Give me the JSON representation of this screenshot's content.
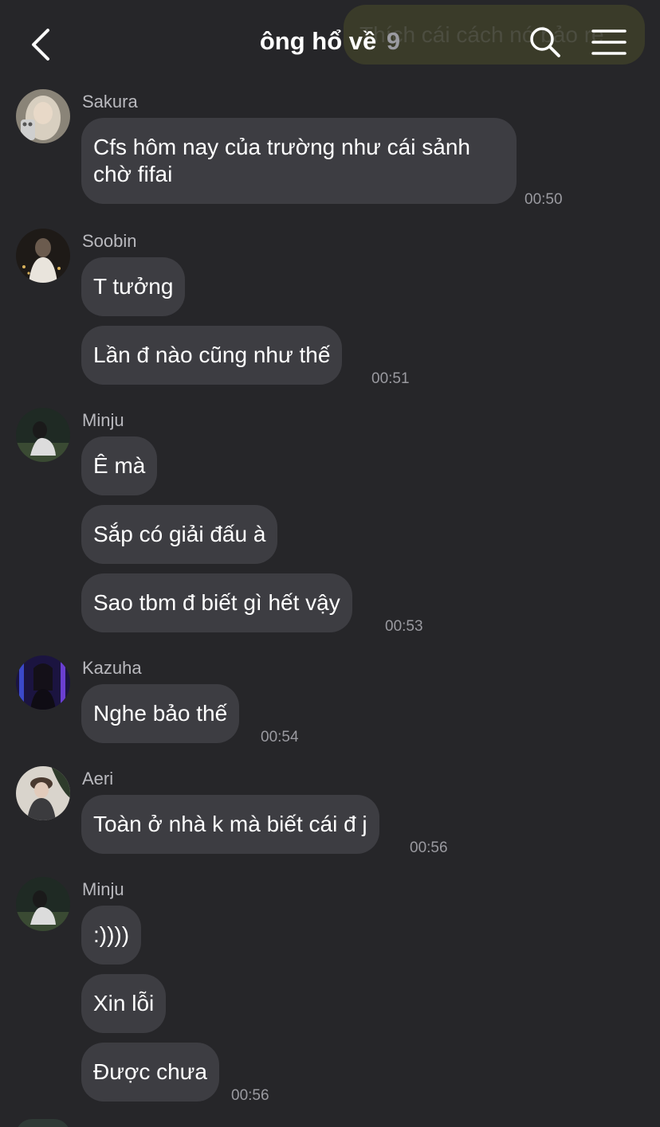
{
  "header": {
    "title": "ông hổ về",
    "member_count": "9",
    "ghost_text": "Thích cái cách nó bảo re"
  },
  "messages": [
    {
      "sender": "Sakura",
      "bubbles": [
        "Cfs hôm nay của trường như cái sảnh chờ fifai"
      ],
      "time": "00:50"
    },
    {
      "sender": "Soobin",
      "bubbles": [
        "T tưởng",
        "Lần đ nào cũng như thế"
      ],
      "time": "00:51"
    },
    {
      "sender": "Minju",
      "bubbles": [
        "Ê mà",
        "Sắp có giải đấu à",
        "Sao tbm đ biết gì hết vậy"
      ],
      "time": "00:53"
    },
    {
      "sender": "Kazuha",
      "bubbles": [
        "Nghe bảo thế"
      ],
      "time": "00:54"
    },
    {
      "sender": "Aeri",
      "bubbles": [
        "Toàn ở nhà k mà biết cái đ j"
      ],
      "time": "00:56"
    },
    {
      "sender": "Minju",
      "bubbles": [
        ":))))",
        "Xin lỗi",
        "Được chưa"
      ],
      "time": "00:56"
    }
  ]
}
